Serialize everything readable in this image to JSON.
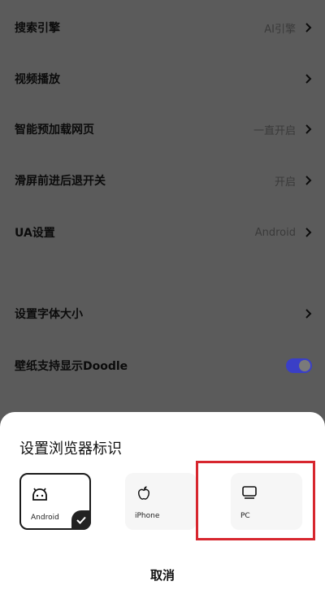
{
  "settings": {
    "items": [
      {
        "label": "搜索引擎",
        "value": "AI引擎",
        "chevron": true
      },
      {
        "label": "视频播放",
        "value": "",
        "chevron": true
      },
      {
        "label": "智能预加载网页",
        "value": "一直开启",
        "chevron": true
      },
      {
        "label": "滑屏前进后退开关",
        "value": "开启",
        "chevron": true
      },
      {
        "label": "UA设置",
        "value": "Android",
        "chevron": true
      },
      {
        "label": "设置字体大小",
        "value": "",
        "chevron": true
      },
      {
        "label": "壁纸支持显示Doodle",
        "value": "",
        "toggle": "on"
      }
    ]
  },
  "dialog": {
    "title": "设置浏览器标识",
    "options": [
      {
        "label": "Android",
        "icon": "android-icon",
        "selected": true
      },
      {
        "label": "iPhone",
        "icon": "apple-icon",
        "selected": false
      },
      {
        "label": "PC",
        "icon": "monitor-icon",
        "selected": false
      }
    ],
    "cancel_label": "取消"
  },
  "colors": {
    "overlay": "#5b5b5b",
    "toggle_on": "#3a3fc7",
    "highlight_box": "#d7262e",
    "sheet_bg": "#ffffff"
  }
}
